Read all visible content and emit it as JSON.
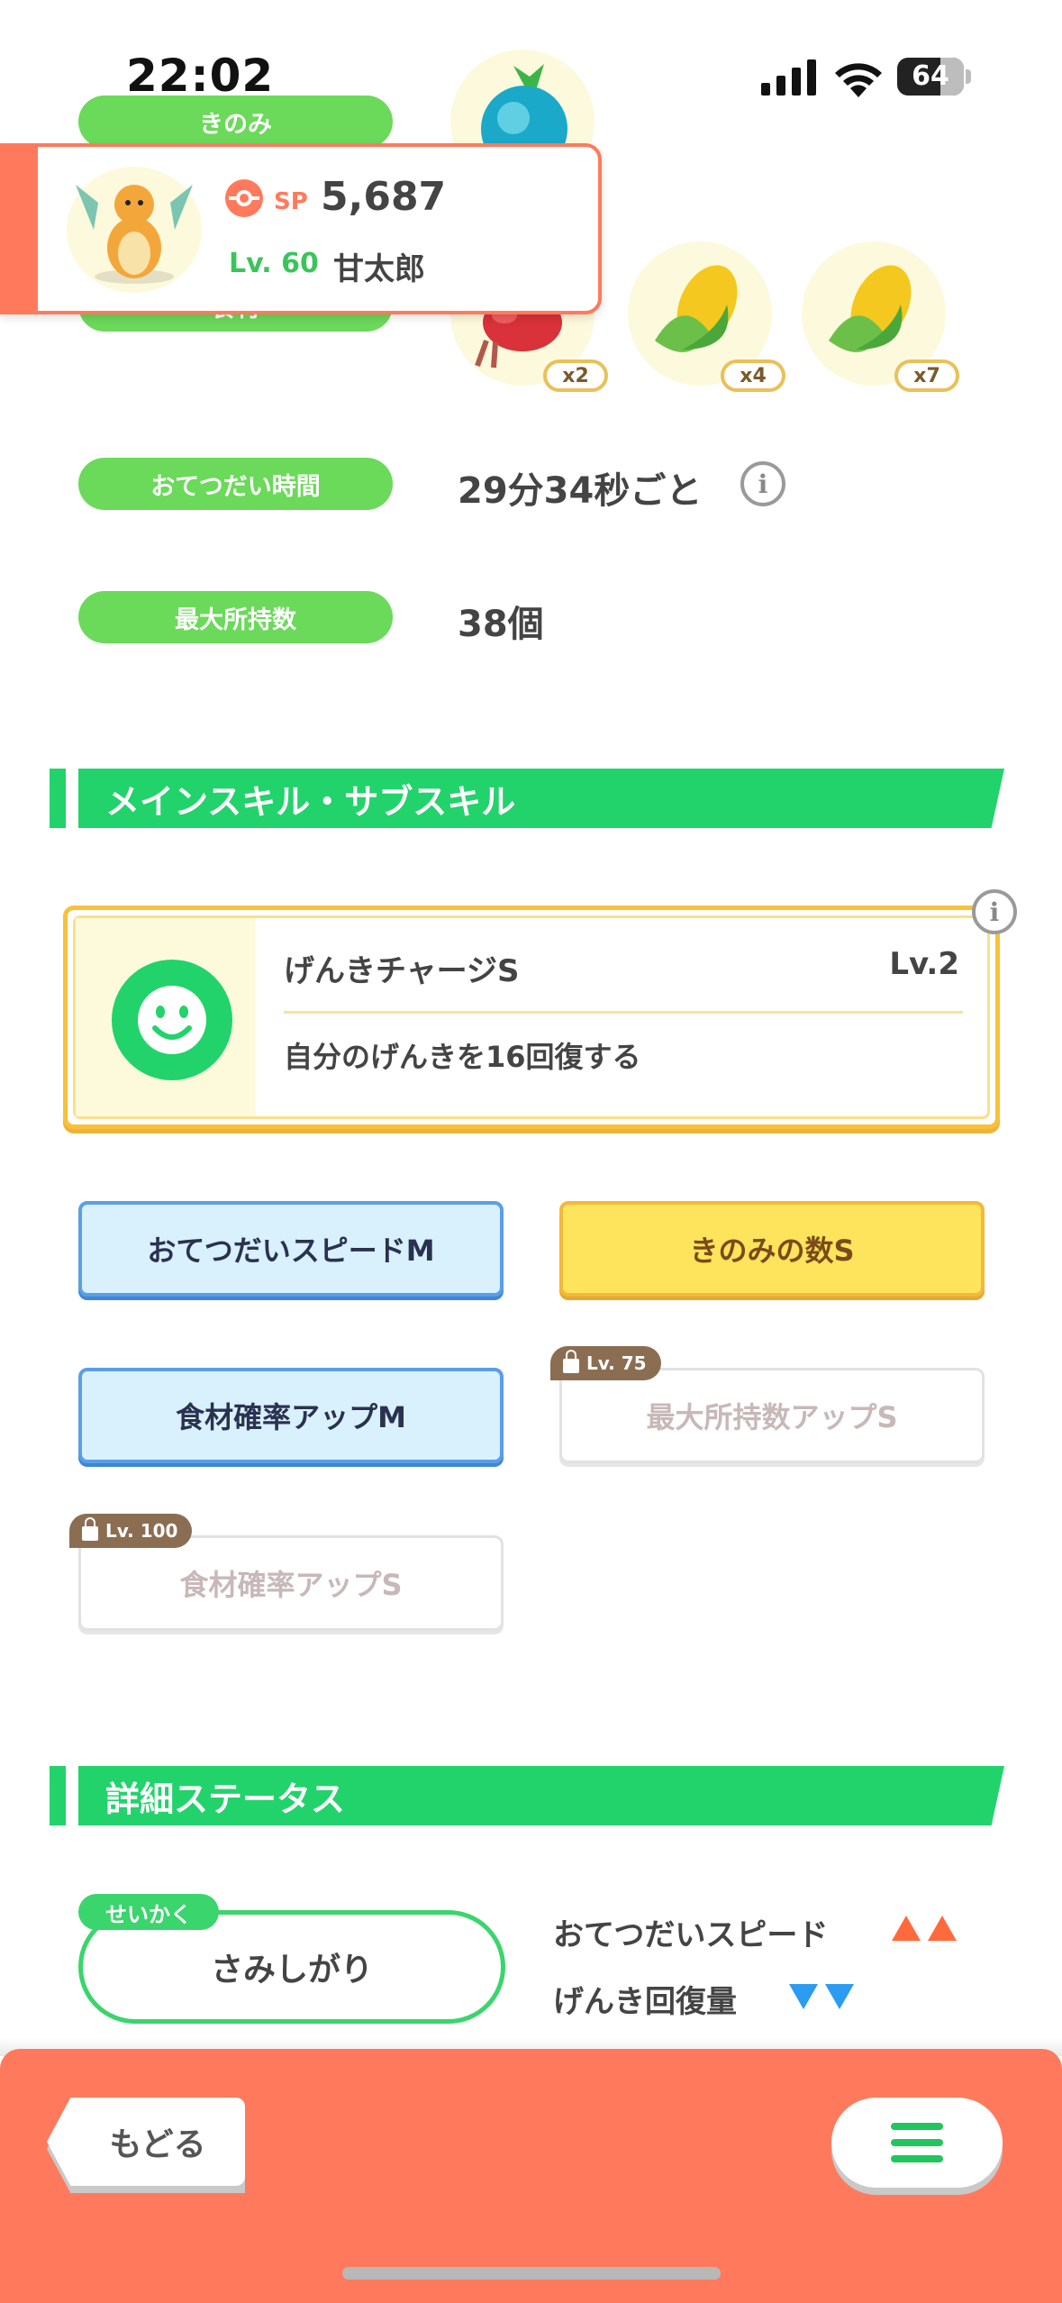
{
  "status": {
    "time": "22:02",
    "battery": "64"
  },
  "labels": {
    "berry": "きのみ",
    "ingredient": "食材",
    "help_time": "おてつだい時間",
    "max_carry": "最大所持数"
  },
  "values": {
    "help_time": "29分34秒ごと",
    "max_carry": "38個"
  },
  "ingredients": [
    {
      "name": "berry-icon",
      "qty": "x2"
    },
    {
      "name": "corn-icon",
      "qty": "x4"
    },
    {
      "name": "corn-icon",
      "qty": "x7"
    }
  ],
  "pokemon_card": {
    "sp_label": "SP",
    "sp_value": "5,687",
    "level": "Lv. 60",
    "name": "甘太郎"
  },
  "sections": {
    "skills": "メインスキル・サブスキル",
    "details": "詳細ステータス"
  },
  "main_skill": {
    "name": "げんきチャージS",
    "level": "Lv.2",
    "description": "自分のげんきを16回復する"
  },
  "sub_skills": [
    {
      "label": "おてつだいスピードM",
      "state": "unlocked"
    },
    {
      "label": "きのみの数S",
      "state": "unlocked"
    },
    {
      "label": "食材確率アップM",
      "state": "unlocked"
    },
    {
      "label": "最大所持数アップS",
      "state": "locked",
      "lock_level": "Lv. 75"
    },
    {
      "label": "食材確率アップS",
      "state": "locked",
      "lock_level": "Lv. 100"
    }
  ],
  "nature": {
    "tag": "せいかく",
    "value": "さみしがり",
    "up_effect": "おてつだいスピード",
    "down_effect": "げんき回復量"
  },
  "bottom": {
    "back": "もどる"
  },
  "colors": {
    "accent_green": "#22d36b",
    "pill_green": "#6bd95a",
    "bottom_orange": "#ff7a5c",
    "up_arrow": "#ff6a3d",
    "down_arrow": "#2b9cf0"
  }
}
